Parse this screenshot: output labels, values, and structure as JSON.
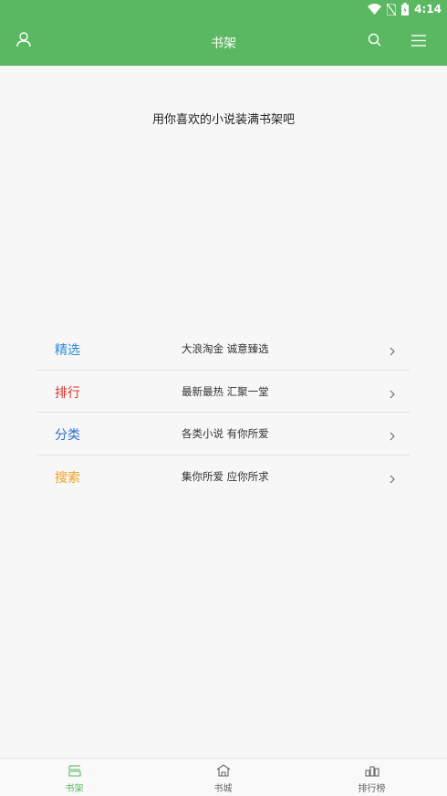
{
  "colors": {
    "brand": "#5bb862",
    "tab_active": "#5bb862",
    "tab_inactive": "#666666"
  },
  "status_bar": {
    "time": "4:14",
    "icons": [
      "wifi-icon",
      "no-sim-icon",
      "battery-icon"
    ]
  },
  "app_bar": {
    "title": "书架",
    "left_icon": "user-icon",
    "right_icons": [
      "search-icon",
      "menu-icon"
    ]
  },
  "empty_state": {
    "message": "用你喜欢的小说装满书架吧"
  },
  "entries": [
    {
      "title": "精选",
      "desc": "大浪淘金  诚意臻选",
      "color": "#2a8ad4"
    },
    {
      "title": "排行",
      "desc": "最新最热  汇聚一堂",
      "color": "#d9382f"
    },
    {
      "title": "分类",
      "desc": "各类小说  有你所爱",
      "color": "#2f6fd0"
    },
    {
      "title": "搜索",
      "desc": "集你所爱  应你所求",
      "color": "#f0a020"
    }
  ],
  "bottom_nav": [
    {
      "label": "书架",
      "icon": "bookshelf-icon",
      "active": true
    },
    {
      "label": "书城",
      "icon": "bookstore-icon",
      "active": false
    },
    {
      "label": "排行榜",
      "icon": "ranking-icon",
      "active": false
    }
  ]
}
